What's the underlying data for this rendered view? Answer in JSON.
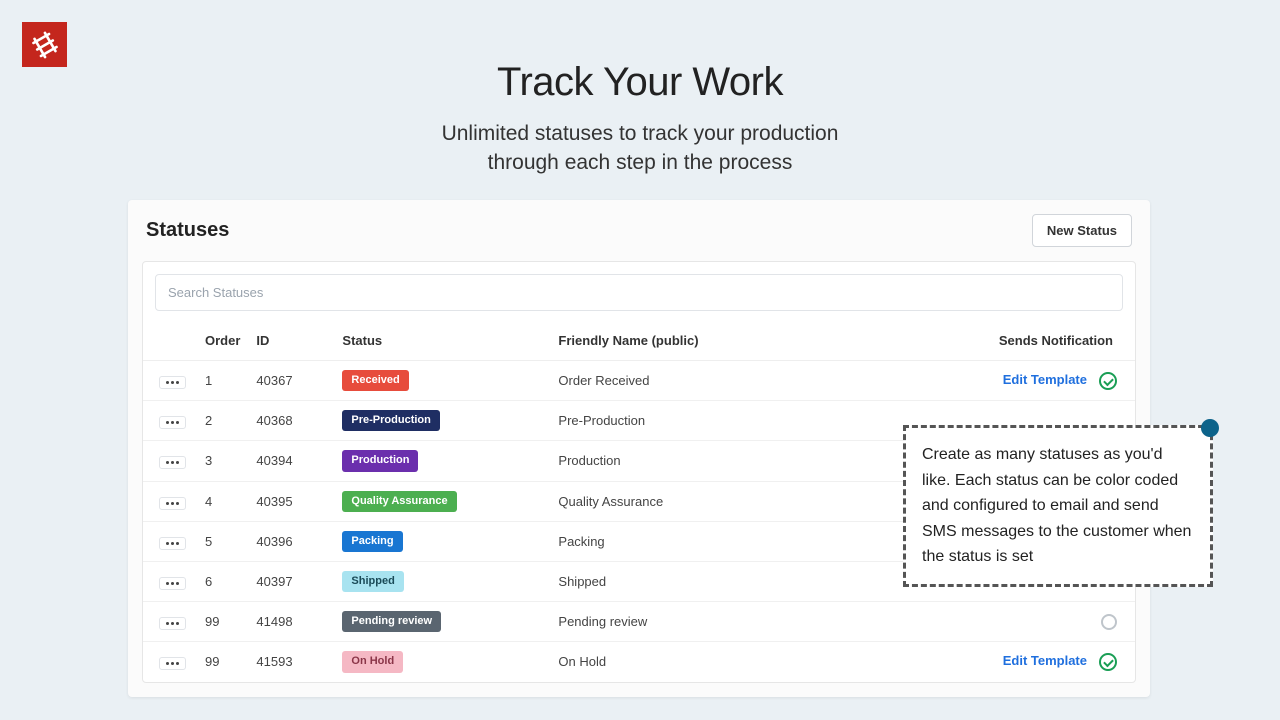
{
  "hero": {
    "title": "Track Your Work",
    "subtitle_line1": "Unlimited statuses to track your production",
    "subtitle_line2": "through each step in the process"
  },
  "panel": {
    "title": "Statuses",
    "new_button": "New Status",
    "search_placeholder": "Search Statuses"
  },
  "columns": {
    "order": "Order",
    "id": "ID",
    "status": "Status",
    "friendly": "Friendly Name (public)",
    "sends": "Sends Notification"
  },
  "edit_label": "Edit Template",
  "rows": [
    {
      "order": "1",
      "id": "40367",
      "badge": "Received",
      "badge_bg": "#e74c3c",
      "badge_fg": "#fff",
      "friendly": "Order Received",
      "edit": true,
      "notif": "on"
    },
    {
      "order": "2",
      "id": "40368",
      "badge": "Pre-Production",
      "badge_bg": "#1f2e63",
      "badge_fg": "#fff",
      "friendly": "Pre-Production",
      "edit": false,
      "notif": "none"
    },
    {
      "order": "3",
      "id": "40394",
      "badge": "Production",
      "badge_bg": "#6b2fad",
      "badge_fg": "#fff",
      "friendly": "Production",
      "edit": false,
      "notif": "none"
    },
    {
      "order": "4",
      "id": "40395",
      "badge": "Quality Assurance",
      "badge_bg": "#4caf50",
      "badge_fg": "#fff",
      "friendly": "Quality Assurance",
      "edit": false,
      "notif": "none"
    },
    {
      "order": "5",
      "id": "40396",
      "badge": "Packing",
      "badge_bg": "#1976d2",
      "badge_fg": "#fff",
      "friendly": "Packing",
      "edit": false,
      "notif": "none"
    },
    {
      "order": "6",
      "id": "40397",
      "badge": "Shipped",
      "badge_bg": "#a8e3f0",
      "badge_fg": "#1a4a57",
      "friendly": "Shipped",
      "edit": false,
      "notif": "none"
    },
    {
      "order": "99",
      "id": "41498",
      "badge": "Pending review",
      "badge_bg": "#5a6570",
      "badge_fg": "#fff",
      "friendly": "Pending review",
      "edit": false,
      "notif": "off"
    },
    {
      "order": "99",
      "id": "41593",
      "badge": "On Hold",
      "badge_bg": "#f5b8c4",
      "badge_fg": "#8a3548",
      "friendly": "On Hold",
      "edit": true,
      "notif": "on"
    }
  ],
  "callout": {
    "text": "Create as many statuses as you'd like. Each status can be color coded and configured to email and send SMS messages to the customer when the status is set"
  }
}
